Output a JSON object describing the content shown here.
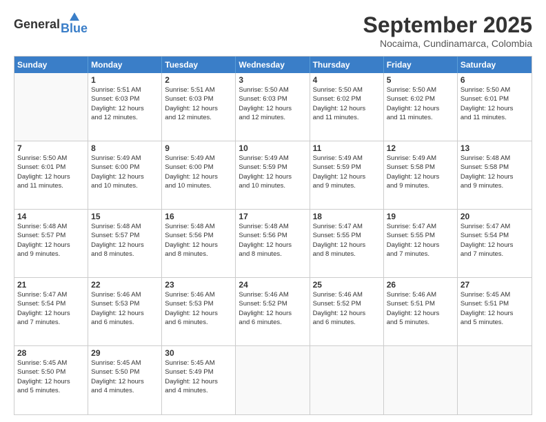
{
  "header": {
    "logo_general": "General",
    "logo_blue": "Blue",
    "month_title": "September 2025",
    "subtitle": "Nocaima, Cundinamarca, Colombia"
  },
  "day_headers": [
    "Sunday",
    "Monday",
    "Tuesday",
    "Wednesday",
    "Thursday",
    "Friday",
    "Saturday"
  ],
  "weeks": [
    [
      {
        "day": "",
        "sunrise": "",
        "sunset": "",
        "daylight": ""
      },
      {
        "day": "1",
        "sunrise": "Sunrise: 5:51 AM",
        "sunset": "Sunset: 6:03 PM",
        "daylight": "Daylight: 12 hours and 12 minutes."
      },
      {
        "day": "2",
        "sunrise": "Sunrise: 5:51 AM",
        "sunset": "Sunset: 6:03 PM",
        "daylight": "Daylight: 12 hours and 12 minutes."
      },
      {
        "day": "3",
        "sunrise": "Sunrise: 5:50 AM",
        "sunset": "Sunset: 6:03 PM",
        "daylight": "Daylight: 12 hours and 12 minutes."
      },
      {
        "day": "4",
        "sunrise": "Sunrise: 5:50 AM",
        "sunset": "Sunset: 6:02 PM",
        "daylight": "Daylight: 12 hours and 11 minutes."
      },
      {
        "day": "5",
        "sunrise": "Sunrise: 5:50 AM",
        "sunset": "Sunset: 6:02 PM",
        "daylight": "Daylight: 12 hours and 11 minutes."
      },
      {
        "day": "6",
        "sunrise": "Sunrise: 5:50 AM",
        "sunset": "Sunset: 6:01 PM",
        "daylight": "Daylight: 12 hours and 11 minutes."
      }
    ],
    [
      {
        "day": "7",
        "sunrise": "Sunrise: 5:50 AM",
        "sunset": "Sunset: 6:01 PM",
        "daylight": "Daylight: 12 hours and 11 minutes."
      },
      {
        "day": "8",
        "sunrise": "Sunrise: 5:49 AM",
        "sunset": "Sunset: 6:00 PM",
        "daylight": "Daylight: 12 hours and 10 minutes."
      },
      {
        "day": "9",
        "sunrise": "Sunrise: 5:49 AM",
        "sunset": "Sunset: 6:00 PM",
        "daylight": "Daylight: 12 hours and 10 minutes."
      },
      {
        "day": "10",
        "sunrise": "Sunrise: 5:49 AM",
        "sunset": "Sunset: 5:59 PM",
        "daylight": "Daylight: 12 hours and 10 minutes."
      },
      {
        "day": "11",
        "sunrise": "Sunrise: 5:49 AM",
        "sunset": "Sunset: 5:59 PM",
        "daylight": "Daylight: 12 hours and 9 minutes."
      },
      {
        "day": "12",
        "sunrise": "Sunrise: 5:49 AM",
        "sunset": "Sunset: 5:58 PM",
        "daylight": "Daylight: 12 hours and 9 minutes."
      },
      {
        "day": "13",
        "sunrise": "Sunrise: 5:48 AM",
        "sunset": "Sunset: 5:58 PM",
        "daylight": "Daylight: 12 hours and 9 minutes."
      }
    ],
    [
      {
        "day": "14",
        "sunrise": "Sunrise: 5:48 AM",
        "sunset": "Sunset: 5:57 PM",
        "daylight": "Daylight: 12 hours and 9 minutes."
      },
      {
        "day": "15",
        "sunrise": "Sunrise: 5:48 AM",
        "sunset": "Sunset: 5:57 PM",
        "daylight": "Daylight: 12 hours and 8 minutes."
      },
      {
        "day": "16",
        "sunrise": "Sunrise: 5:48 AM",
        "sunset": "Sunset: 5:56 PM",
        "daylight": "Daylight: 12 hours and 8 minutes."
      },
      {
        "day": "17",
        "sunrise": "Sunrise: 5:48 AM",
        "sunset": "Sunset: 5:56 PM",
        "daylight": "Daylight: 12 hours and 8 minutes."
      },
      {
        "day": "18",
        "sunrise": "Sunrise: 5:47 AM",
        "sunset": "Sunset: 5:55 PM",
        "daylight": "Daylight: 12 hours and 8 minutes."
      },
      {
        "day": "19",
        "sunrise": "Sunrise: 5:47 AM",
        "sunset": "Sunset: 5:55 PM",
        "daylight": "Daylight: 12 hours and 7 minutes."
      },
      {
        "day": "20",
        "sunrise": "Sunrise: 5:47 AM",
        "sunset": "Sunset: 5:54 PM",
        "daylight": "Daylight: 12 hours and 7 minutes."
      }
    ],
    [
      {
        "day": "21",
        "sunrise": "Sunrise: 5:47 AM",
        "sunset": "Sunset: 5:54 PM",
        "daylight": "Daylight: 12 hours and 7 minutes."
      },
      {
        "day": "22",
        "sunrise": "Sunrise: 5:46 AM",
        "sunset": "Sunset: 5:53 PM",
        "daylight": "Daylight: 12 hours and 6 minutes."
      },
      {
        "day": "23",
        "sunrise": "Sunrise: 5:46 AM",
        "sunset": "Sunset: 5:53 PM",
        "daylight": "Daylight: 12 hours and 6 minutes."
      },
      {
        "day": "24",
        "sunrise": "Sunrise: 5:46 AM",
        "sunset": "Sunset: 5:52 PM",
        "daylight": "Daylight: 12 hours and 6 minutes."
      },
      {
        "day": "25",
        "sunrise": "Sunrise: 5:46 AM",
        "sunset": "Sunset: 5:52 PM",
        "daylight": "Daylight: 12 hours and 6 minutes."
      },
      {
        "day": "26",
        "sunrise": "Sunrise: 5:46 AM",
        "sunset": "Sunset: 5:51 PM",
        "daylight": "Daylight: 12 hours and 5 minutes."
      },
      {
        "day": "27",
        "sunrise": "Sunrise: 5:45 AM",
        "sunset": "Sunset: 5:51 PM",
        "daylight": "Daylight: 12 hours and 5 minutes."
      }
    ],
    [
      {
        "day": "28",
        "sunrise": "Sunrise: 5:45 AM",
        "sunset": "Sunset: 5:50 PM",
        "daylight": "Daylight: 12 hours and 5 minutes."
      },
      {
        "day": "29",
        "sunrise": "Sunrise: 5:45 AM",
        "sunset": "Sunset: 5:50 PM",
        "daylight": "Daylight: 12 hours and 4 minutes."
      },
      {
        "day": "30",
        "sunrise": "Sunrise: 5:45 AM",
        "sunset": "Sunset: 5:49 PM",
        "daylight": "Daylight: 12 hours and 4 minutes."
      },
      {
        "day": "",
        "sunrise": "",
        "sunset": "",
        "daylight": ""
      },
      {
        "day": "",
        "sunrise": "",
        "sunset": "",
        "daylight": ""
      },
      {
        "day": "",
        "sunrise": "",
        "sunset": "",
        "daylight": ""
      },
      {
        "day": "",
        "sunrise": "",
        "sunset": "",
        "daylight": ""
      }
    ]
  ]
}
